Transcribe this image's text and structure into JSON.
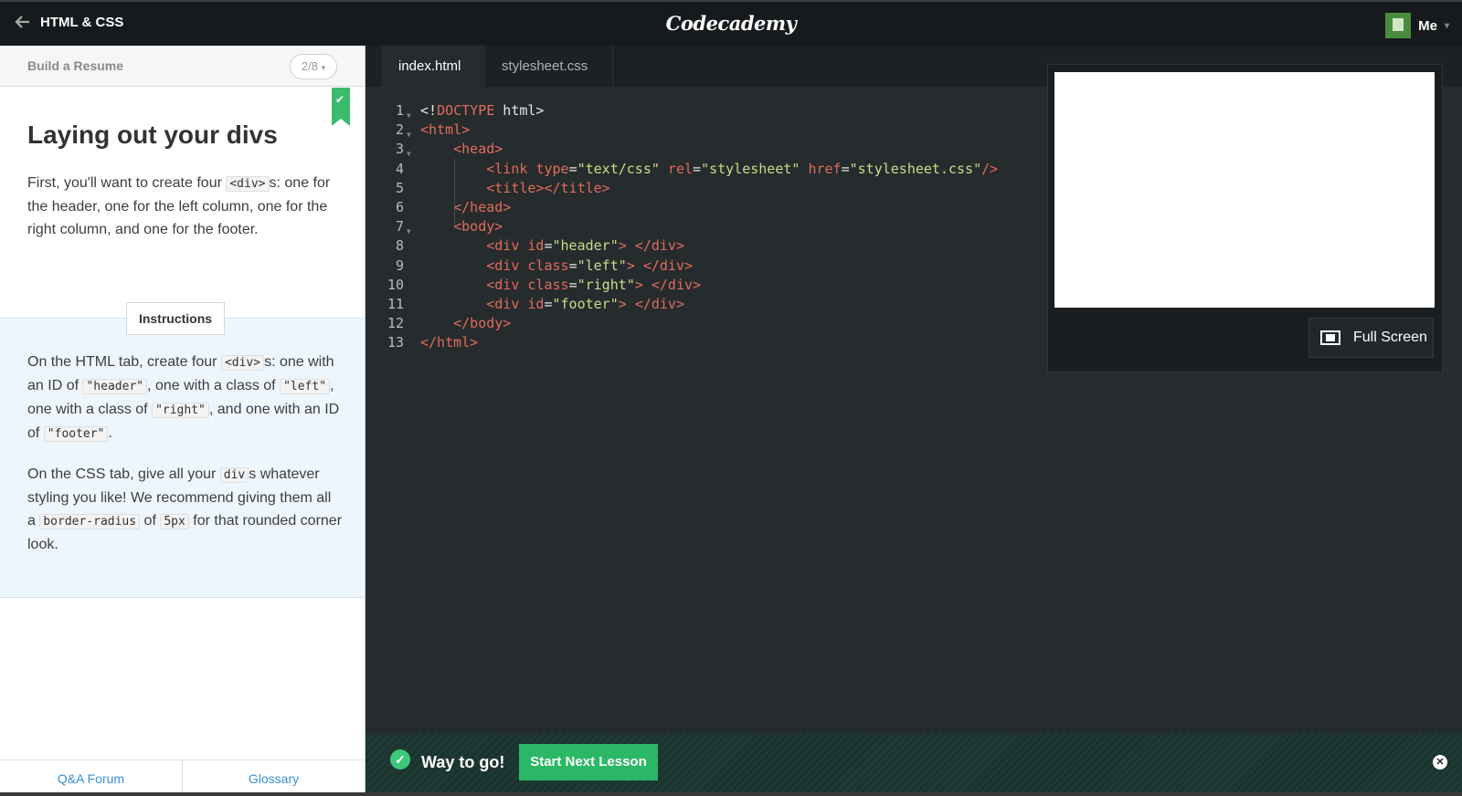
{
  "topbar": {
    "course": "HTML & CSS",
    "logo": "Codecademy",
    "user": "Me"
  },
  "lesson": {
    "header": "Build a Resume",
    "progress": "2/8",
    "title": "Laying out your divs",
    "intro": [
      "First, you'll want to create four ",
      "<div>",
      "s: one for the header, one for the left column, one for the right column, and one for the footer."
    ],
    "instructions_label": "Instructions",
    "instr1": [
      "On the HTML tab, create four ",
      "<div>",
      "s: one with an ID of ",
      "\"header\"",
      ", one with a class of ",
      "\"left\"",
      ", one with a class of ",
      "\"right\"",
      ", and one with an ID of ",
      "\"footer\"",
      "."
    ],
    "instr2": [
      "On the CSS tab, give all your ",
      "div",
      "s whatever styling you like! We recommend giving them all a ",
      "border-radius",
      " of ",
      "5px",
      " for that rounded corner look."
    ],
    "footer": {
      "qa": "Q&A Forum",
      "glossary": "Glossary"
    }
  },
  "editor": {
    "tabs": [
      "index.html",
      "stylesheet.css"
    ],
    "lines": [
      {
        "n": "1",
        "fold": true,
        "segs": [
          [
            "plain",
            "<!"
          ],
          [
            "tag",
            "DOCTYPE"
          ],
          [
            "plain",
            " html>"
          ]
        ]
      },
      {
        "n": "2",
        "fold": true,
        "segs": [
          [
            "tag",
            "<html>"
          ]
        ]
      },
      {
        "n": "3",
        "fold": true,
        "segs": [
          [
            "plain",
            "    "
          ],
          [
            "tag",
            "<head>"
          ]
        ]
      },
      {
        "n": "4",
        "fold": false,
        "segs": [
          [
            "plain",
            "        "
          ],
          [
            "tag",
            "<link "
          ],
          [
            "attr",
            "type"
          ],
          [
            "plain",
            "="
          ],
          [
            "str",
            "\"text/css\""
          ],
          [
            "attr",
            " rel"
          ],
          [
            "plain",
            "="
          ],
          [
            "str",
            "\"stylesheet\""
          ],
          [
            "attr",
            " href"
          ],
          [
            "plain",
            "="
          ],
          [
            "str",
            "\"stylesheet.css\""
          ],
          [
            "tag",
            "/>"
          ]
        ]
      },
      {
        "n": "5",
        "fold": false,
        "segs": [
          [
            "plain",
            "        "
          ],
          [
            "tag",
            "<title></title>"
          ]
        ]
      },
      {
        "n": "6",
        "fold": false,
        "segs": [
          [
            "plain",
            "    "
          ],
          [
            "tag",
            "</head>"
          ]
        ]
      },
      {
        "n": "7",
        "fold": true,
        "segs": [
          [
            "plain",
            "    "
          ],
          [
            "tag",
            "<body>"
          ]
        ]
      },
      {
        "n": "8",
        "fold": false,
        "segs": [
          [
            "plain",
            "        "
          ],
          [
            "tag",
            "<div "
          ],
          [
            "attr",
            "id"
          ],
          [
            "plain",
            "="
          ],
          [
            "str",
            "\"header\""
          ],
          [
            "tag",
            "> </div>"
          ]
        ]
      },
      {
        "n": "9",
        "fold": false,
        "segs": [
          [
            "plain",
            "        "
          ],
          [
            "tag",
            "<div "
          ],
          [
            "attr",
            "class"
          ],
          [
            "plain",
            "="
          ],
          [
            "str",
            "\"left\""
          ],
          [
            "tag",
            "> </div>"
          ]
        ]
      },
      {
        "n": "10",
        "fold": false,
        "segs": [
          [
            "plain",
            "        "
          ],
          [
            "tag",
            "<div "
          ],
          [
            "attr",
            "class"
          ],
          [
            "plain",
            "="
          ],
          [
            "str",
            "\"right\""
          ],
          [
            "tag",
            "> </div>"
          ]
        ]
      },
      {
        "n": "11",
        "fold": false,
        "segs": [
          [
            "plain",
            "        "
          ],
          [
            "tag",
            "<div "
          ],
          [
            "attr",
            "id"
          ],
          [
            "plain",
            "="
          ],
          [
            "str",
            "\"footer\""
          ],
          [
            "tag",
            "> </div>"
          ]
        ]
      },
      {
        "n": "12",
        "fold": false,
        "segs": [
          [
            "plain",
            "    "
          ],
          [
            "tag",
            "</body>"
          ]
        ]
      },
      {
        "n": "13",
        "fold": false,
        "segs": [
          [
            "tag",
            "</html>"
          ]
        ]
      }
    ]
  },
  "preview": {
    "fullscreen_label": "Full Screen"
  },
  "success": {
    "message": "Way to go!",
    "next_label": "Start Next Lesson"
  }
}
